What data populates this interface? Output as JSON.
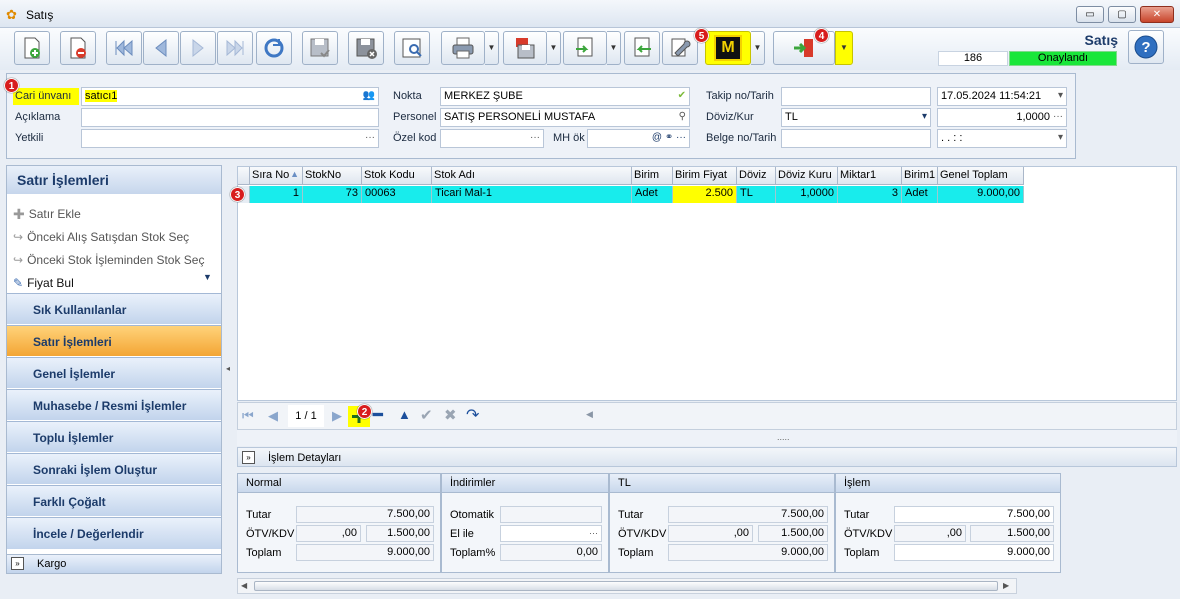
{
  "window": {
    "title": "Satış",
    "minimize": "▭",
    "maximize": "▢",
    "close": "✕"
  },
  "toolbar": {
    "module_title": "Satış",
    "record_count": "186",
    "status": "Onaylandı",
    "m_label": "M"
  },
  "badges": {
    "b1": "1",
    "b2": "2",
    "b3": "3",
    "b4": "4",
    "b5": "5"
  },
  "header": {
    "cari_unvani_label": "Cari ünvanı",
    "cari_unvani_value": "satıcı1",
    "aciklama_label": "Açıklama",
    "yetkili_label": "Yetkili",
    "nokta_label": "Nokta",
    "nokta_value": "MERKEZ ŞUBE",
    "personel_label": "Personel",
    "personel_value": "SATIŞ PERSONELİ MUSTAFA",
    "ozel_kod_label": "Özel kod",
    "mh_ok_label": "MH ök",
    "takip_label": "Takip no/Tarih",
    "takip_date": "17.05.2024 11:54:21",
    "doviz_label": "Döviz/Kur",
    "doviz_value": "TL",
    "kur_value": "1,0000",
    "belge_label": "Belge no/Tarih",
    "belge_date": ". .    : :"
  },
  "left": {
    "header": "Satır İşlemleri",
    "actions": [
      "Satır Ekle",
      "Önceki Alış Satışdan Stok Seç",
      "Önceki Stok İşleminden Stok Seç",
      "Fiyat Bul"
    ],
    "nav": [
      "Sık Kullanılanlar",
      "Satır İşlemleri",
      "Genel İşlemler",
      "Muhasebe / Resmi İşlemler",
      "Toplu İşlemler",
      "Sonraki İşlem Oluştur",
      "Farklı Çoğalt",
      "İncele / Değerlendir"
    ],
    "kargo": "Kargo"
  },
  "grid": {
    "columns": [
      "Sıra No",
      "StokNo",
      "Stok Kodu",
      "Stok Adı",
      "Birim",
      "Birim Fiyat",
      "Döviz",
      "Döviz Kuru",
      "Miktar1",
      "Birim1",
      "Genel Toplam"
    ],
    "rows": [
      [
        "1",
        "73",
        "00063",
        "Ticari  Mal-1",
        "Adet",
        "2.500",
        "TL",
        "1,0000",
        "3",
        "Adet",
        "9.000,00"
      ]
    ],
    "page": "1 / 1"
  },
  "details": {
    "title": "İşlem Detayları",
    "normal": {
      "header": "Normal",
      "tutar_label": "Tutar",
      "tutar": "7.500,00",
      "otv_label": "ÖTV/KDV",
      "otv": ",00",
      "kdv": "1.500,00",
      "toplam_label": "Toplam",
      "toplam": "9.000,00"
    },
    "indirimler": {
      "header": "İndirimler",
      "otomatik_label": "Otomatik",
      "el_ile_label": "El ile",
      "toplam_pct_label": "Toplam%",
      "toplam_pct": "0,00"
    },
    "tl": {
      "header": "TL",
      "tutar_label": "Tutar",
      "tutar": "7.500,00",
      "otv_label": "ÖTV/KDV",
      "otv": ",00",
      "kdv": "1.500,00",
      "toplam_label": "Toplam",
      "toplam": "9.000,00"
    },
    "islem": {
      "header": "İşlem",
      "tutar_label": "Tutar",
      "tutar": "7.500,00",
      "otv_label": "ÖTV/KDV",
      "otv": ",00",
      "kdv": "1.500,00",
      "toplam_label": "Toplam",
      "toplam": "9.000,00"
    }
  },
  "colors": {
    "accent": "#1c3b6a",
    "status_green": "#19e63a",
    "row_highlight": "#18ecec",
    "cell_highlight": "#ffff00",
    "badge": "#d81d1d",
    "active_nav": "#f3a534"
  }
}
